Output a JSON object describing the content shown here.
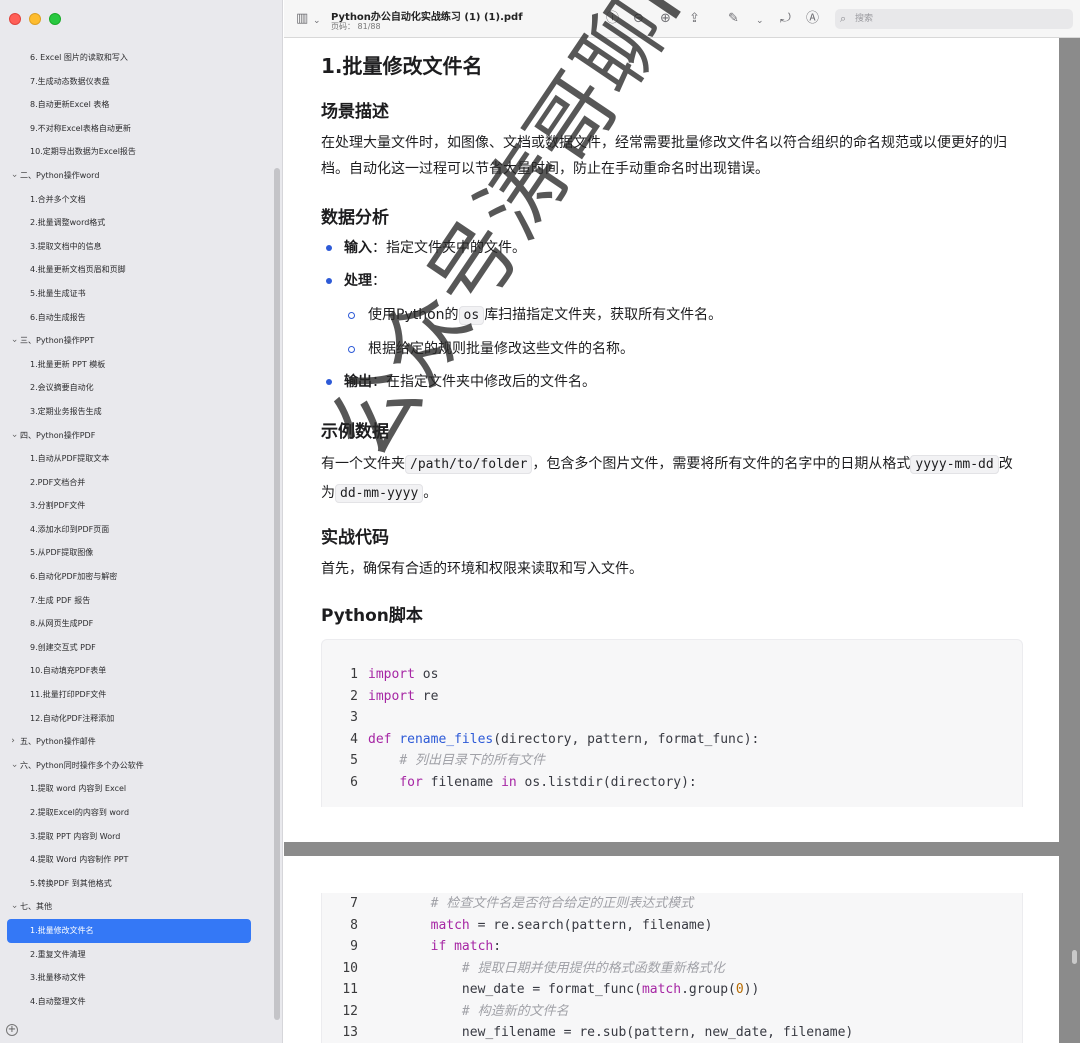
{
  "window": {
    "title": "Python办公自动化实战练习 (1) (1).pdf",
    "page_indicator": "页码： 81/88",
    "search_placeholder": "搜索"
  },
  "sidebar": {
    "items": [
      {
        "label": "6. Excel 图片的读取和写入",
        "level": 1
      },
      {
        "label": "7.生成动态数据仪表盘",
        "level": 1
      },
      {
        "label": "8.自动更新Excel 表格",
        "level": 1
      },
      {
        "label": "9.不对称Excel表格自动更新",
        "level": 1
      },
      {
        "label": "10.定期导出数据为Excel报告",
        "level": 1
      },
      {
        "label": "二、Python操作word",
        "level": 0
      },
      {
        "label": "1.合并多个文档",
        "level": 1
      },
      {
        "label": "2.批量调整word格式",
        "level": 1
      },
      {
        "label": "3.提取文档中的信息",
        "level": 1
      },
      {
        "label": "4.批量更新文档页眉和页脚",
        "level": 1
      },
      {
        "label": "5.批量生成证书",
        "level": 1
      },
      {
        "label": "6.自动生成报告",
        "level": 1
      },
      {
        "label": "三、Python操作PPT",
        "level": 0
      },
      {
        "label": "1.批量更新 PPT 模板",
        "level": 1
      },
      {
        "label": "2.会议摘要自动化",
        "level": 1
      },
      {
        "label": "3.定期业务报告生成",
        "level": 1
      },
      {
        "label": "四、Python操作PDF",
        "level": 0
      },
      {
        "label": "1.自动从PDF提取文本",
        "level": 1
      },
      {
        "label": "2.PDF文档合并",
        "level": 1
      },
      {
        "label": "3.分割PDF文件",
        "level": 1
      },
      {
        "label": "4.添加水印到PDF页面",
        "level": 1
      },
      {
        "label": "5.从PDF提取图像",
        "level": 1
      },
      {
        "label": "6.自动化PDF加密与解密",
        "level": 1
      },
      {
        "label": "7.生成 PDF 报告",
        "level": 1
      },
      {
        "label": "8.从网页生成PDF",
        "level": 1
      },
      {
        "label": "9.创建交互式 PDF",
        "level": 1
      },
      {
        "label": "10.自动填充PDF表单",
        "level": 1
      },
      {
        "label": "11.批量打印PDF文件",
        "level": 1
      },
      {
        "label": "12.自动化PDF注释添加",
        "level": 1
      },
      {
        "label": "五、Python操作邮件",
        "level": 0,
        "collapsed": true
      },
      {
        "label": "六、Python同时操作多个办公软件",
        "level": 0
      },
      {
        "label": "1.提取 word 内容到 Excel",
        "level": 1
      },
      {
        "label": "2.提取Excel的内容到 word",
        "level": 1
      },
      {
        "label": "3.提取 PPT 内容到 Word",
        "level": 1
      },
      {
        "label": "4.提取 Word 内容制作 PPT",
        "level": 1
      },
      {
        "label": "5.转换PDF 到其他格式",
        "level": 1
      },
      {
        "label": "七、其他",
        "level": 0
      },
      {
        "label": "1.批量修改文件名",
        "level": 1,
        "active": true
      },
      {
        "label": "2.重复文件清理",
        "level": 1
      },
      {
        "label": "3.批量移动文件",
        "level": 1
      },
      {
        "label": "4.自动整理文件",
        "level": 1
      }
    ]
  },
  "doc": {
    "heading": "1.批量修改文件名",
    "s1_title": "场景描述",
    "s1_text": "在处理大量文件时，如图像、文档或数据文件，经常需要批量修改文件名以符合组织的命名规范或以便更好的归档。自动化这一过程可以节省大量时间，防止在手动重命名时出现错误。",
    "s2_title": "数据分析",
    "b1_label": "输入",
    "b1_text": "：指定文件夹中的文件。",
    "b2_label": "处理",
    "b2_text": "：",
    "sb1_pre": "使用Python的",
    "sb1_code": "os",
    "sb1_post": "库扫描指定文件夹，获取所有文件名。",
    "sb2_text": "根据给定的规则批量修改这些文件的名称。",
    "b3_label": "输出",
    "b3_text": "：在指定文件夹中修改后的文件名。",
    "s3_title": "示例数据",
    "s3_pre": "有一个文件夹",
    "s3_code1": "/path/to/folder",
    "s3_mid": "，包含多个图片文件，需要将所有文件的名字中的日期从格式",
    "s3_code2": "yyyy-mm-dd",
    "s3_mid2": "改为",
    "s3_code3": "dd-mm-yyyy",
    "s3_end": "。",
    "s4_title": "实战代码",
    "s4_text": "首先，确保有合适的环境和权限来读取和写入文件。",
    "s5_title": "Python脚本",
    "watermark": "公众号涛哥聊Pytho",
    "code_page1": [
      {
        "n": "1",
        "t": "import os"
      },
      {
        "n": "2",
        "t": "import re"
      },
      {
        "n": "3",
        "t": ""
      },
      {
        "n": "4",
        "t": "def rename_files(directory, pattern, format_func):"
      },
      {
        "n": "5",
        "t": "    # 列出目录下的所有文件"
      },
      {
        "n": "6",
        "t": "    for filename in os.listdir(directory):"
      }
    ],
    "code_page2": [
      {
        "n": "7",
        "t": "        # 检查文件名是否符合给定的正则表达式模式"
      },
      {
        "n": "8",
        "t": "        match = re.search(pattern, filename)"
      },
      {
        "n": "9",
        "t": "        if match:"
      },
      {
        "n": "10",
        "t": "            # 提取日期并使用提供的格式函数重新格式化"
      },
      {
        "n": "11",
        "t": "            new_date = format_func(match.group(0))"
      },
      {
        "n": "12",
        "t": "            # 构造新的文件名"
      },
      {
        "n": "13",
        "t": "            new_filename = re.sub(pattern, new_date, filename)"
      }
    ]
  }
}
